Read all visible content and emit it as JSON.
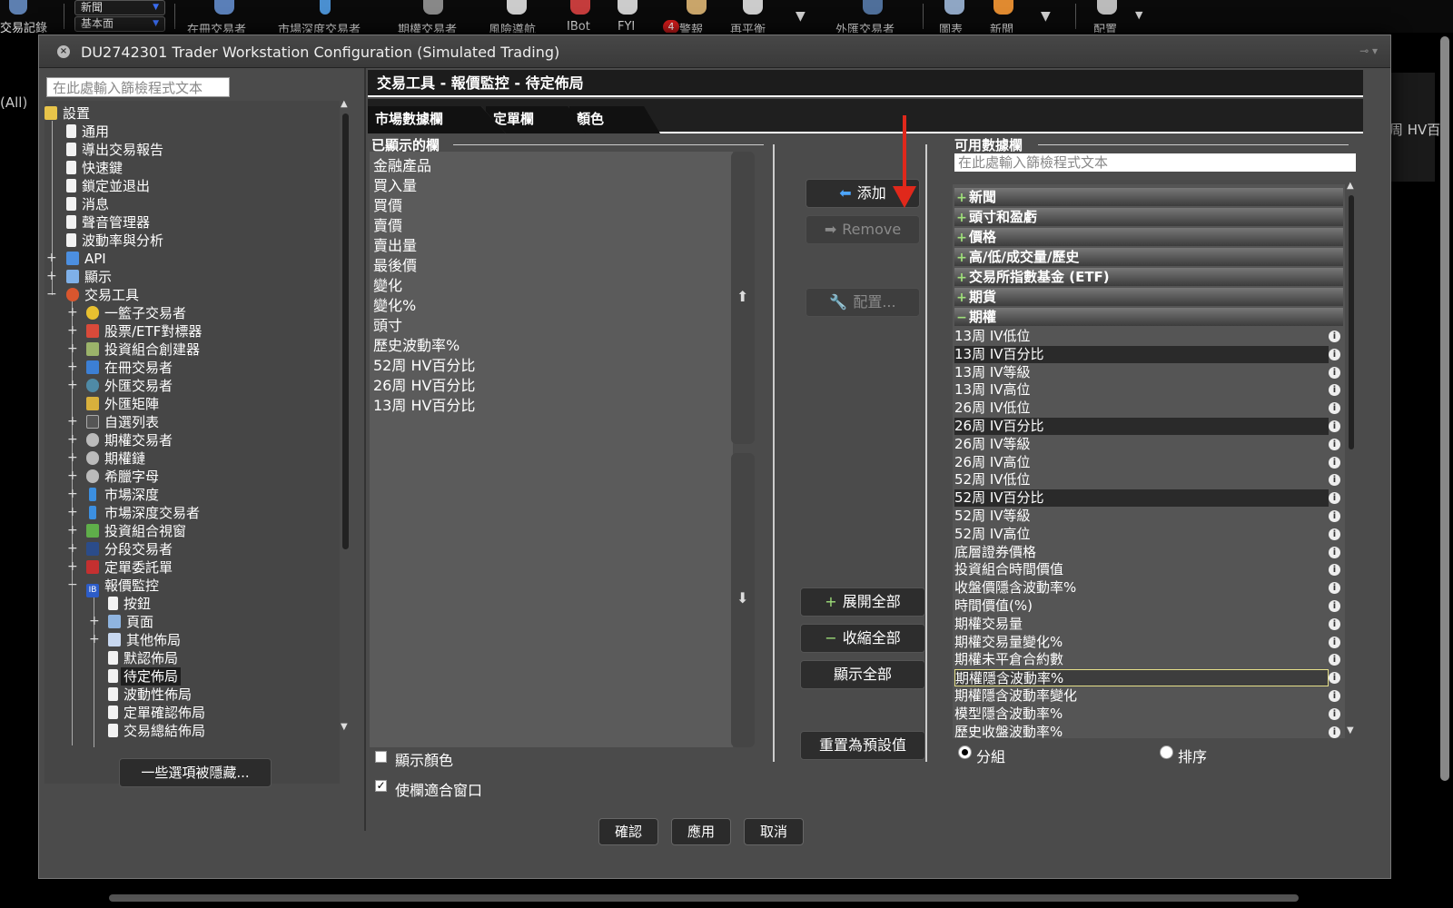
{
  "toolbar": {
    "left_label": "交易記錄",
    "workspace_top": "新聞",
    "workspace_bottom": "基本面",
    "items": [
      {
        "label": "在冊交易者",
        "icon": "trader-icon"
      },
      {
        "label": "市場深度交易者",
        "icon": "depth-icon"
      },
      {
        "label": "期權交易者",
        "icon": "options-icon"
      },
      {
        "label": "風險導航",
        "icon": "risk-navigator-icon"
      },
      {
        "label": "IBot",
        "icon": "ibot-icon"
      },
      {
        "label": "FYI",
        "icon": "fyi-icon"
      },
      {
        "label": "警報",
        "icon": "alert-icon"
      },
      {
        "label": "再平衡",
        "icon": "rebalance-icon"
      },
      {
        "label": "外匯交易者",
        "icon": "fx-icon"
      },
      {
        "label": "圖表",
        "icon": "chart-icon"
      },
      {
        "label": "新聞",
        "icon": "news-icon"
      },
      {
        "label": "配置",
        "icon": "config-icon"
      }
    ],
    "fyi_count": "4"
  },
  "background": {
    "left_label": "(All)",
    "right_label": "周 HV百"
  },
  "dialog": {
    "title": "DU2742301 Trader Workstation Configuration (Simulated Trading)",
    "left_filter_placeholder": "在此處輸入篩檢程式文本",
    "hidden_options_button": "一些選項被隱藏...",
    "tree": {
      "root": "設置",
      "general": "通用",
      "export_trade_reports": "導出交易報告",
      "hotkeys": "快速鍵",
      "lock_and_exit": "鎖定並退出",
      "messages": "消息",
      "sound_manager": "聲音管理器",
      "volatility_analytics": "波動率與分析",
      "api": "API",
      "display": "顯示",
      "trading_tools": "交易工具",
      "basket_trader": "一籃子交易者",
      "stock_etf_comparator": "股票/ETF對標器",
      "portfolio_builder": "投資組合創建器",
      "book_trader": "在冊交易者",
      "fx_trader": "外匯交易者",
      "fx_matrix": "外匯矩陣",
      "watchlist": "自選列表",
      "option_trader": "期權交易者",
      "option_chain": "期權鏈",
      "greeks": "希臘字母",
      "market_depth": "市場深度",
      "market_depth_trader": "市場深度交易者",
      "portfolio_view": "投資組合視窗",
      "scale_trader": "分段交易者",
      "order_ticket": "定單委託單",
      "quote_monitor": "報價監控",
      "buttons": "按鈕",
      "pages": "頁面",
      "other_layouts": "其他佈局",
      "default_layout": "默認佈局",
      "pending_layout": "待定佈局",
      "volatility_layout": "波動性佈局",
      "order_confirm_layout": "定單確認佈局",
      "trade_summary_layout": "交易總結佈局"
    },
    "panel_title": "交易工具 - 報價監控 - 待定佈局",
    "tabs": [
      "市場數據欄",
      "定單欄",
      "顏色"
    ],
    "shown_columns_label": "已顯示的欄",
    "shown_columns": [
      "金融產品",
      "買入量",
      "買價",
      "賣價",
      "賣出量",
      "最後價",
      "變化",
      "變化%",
      "頭寸",
      "歷史波動率%",
      "52周 HV百分比",
      "26周 HV百分比",
      "13周 HV百分比"
    ],
    "show_colors_label": "顯示顏色",
    "show_colors_checked": false,
    "fit_window_label": "使欄適合窗口",
    "fit_window_checked": true,
    "buttons": {
      "add": "添加",
      "remove": "Remove",
      "configure": "配置...",
      "expand_all": "展開全部",
      "collapse_all": "收縮全部",
      "show_all": "顯示全部",
      "reset_defaults": "重置為預設值"
    },
    "available_label": "可用數據欄",
    "available_filter_placeholder": "在此處輸入篩檢程式文本",
    "groups": [
      {
        "label": "新聞",
        "sign": "+"
      },
      {
        "label": "頭寸和盈虧",
        "sign": "+"
      },
      {
        "label": "價格",
        "sign": "+"
      },
      {
        "label": "高/低/成交量/歷史",
        "sign": "+"
      },
      {
        "label": "交易所指數基金 (ETF)",
        "sign": "+"
      },
      {
        "label": "期貨",
        "sign": "+"
      },
      {
        "label": "期權",
        "sign": "−"
      }
    ],
    "option_items": [
      "13周 IV低位",
      "13周 IV百分比",
      "13周 IV等級",
      "13周 IV高位",
      "26周 IV低位",
      "26周 IV百分比",
      "26周 IV等級",
      "26周 IV高位",
      "52周 IV低位",
      "52周 IV百分比",
      "52周 IV等級",
      "52周 IV高位",
      "底層證券價格",
      "投資組合時間價值",
      "收盤價隱含波動率%",
      "時間價值(%)",
      "期權交易量",
      "期權交易量變化%",
      "期權未平倉合約數",
      "期權隱含波動率%",
      "期權隱含波動率變化",
      "模型隱含波動率%",
      "歷史收盤波動率%"
    ],
    "radio_group": "分組",
    "radio_sort": "排序",
    "radio_selected": "分組",
    "footer": {
      "ok": "確認",
      "apply": "應用",
      "cancel": "取消"
    }
  },
  "colors": {
    "annotation_arrow": "#e0281b",
    "dialog_bg": "#4b4b4b",
    "list_bg": "#5b5b5b"
  }
}
